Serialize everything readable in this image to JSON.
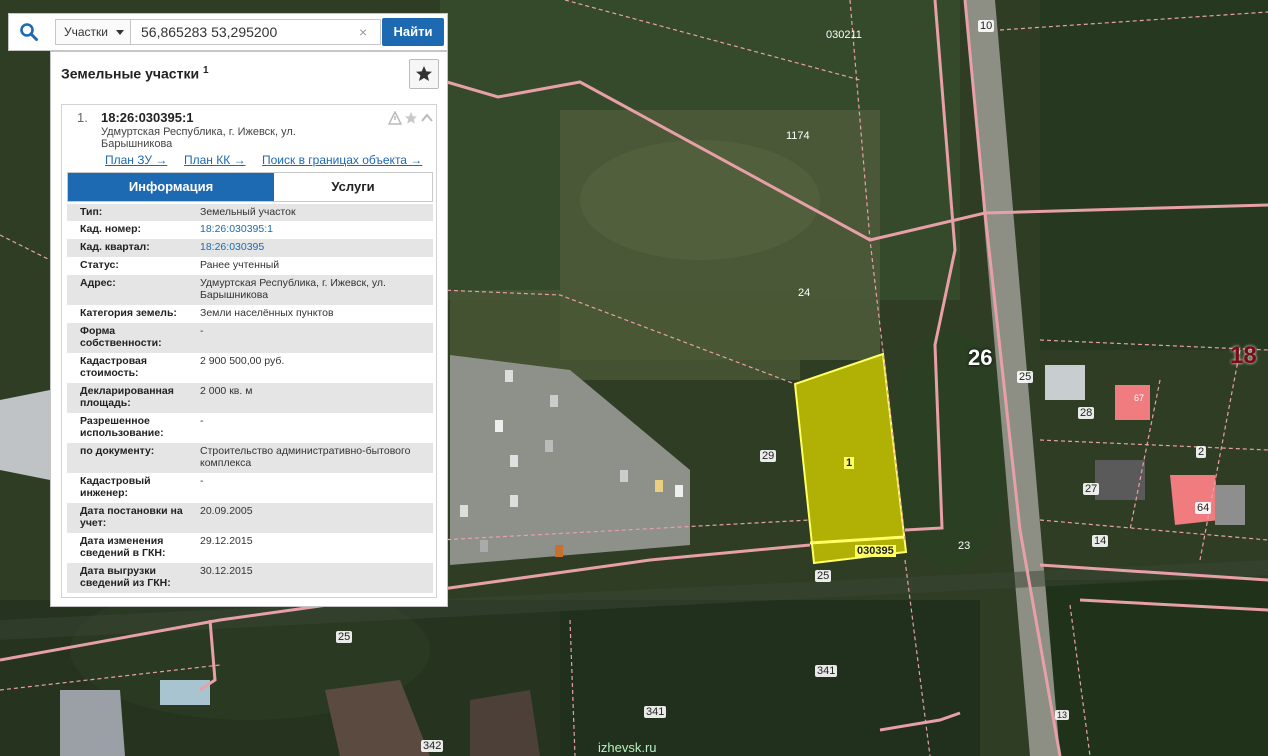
{
  "search": {
    "type_label": "Участки",
    "query": "56,865283 53,295200",
    "clear_symbol": "×",
    "find_label": "Найти"
  },
  "panel": {
    "title": "Земельные участки",
    "title_count": "1",
    "item": {
      "number": "1.",
      "cad_number": "18:26:030395:1",
      "address": "Удмуртская Республика, г. Ижевск, ул. Барышникова",
      "links": [
        "План ЗУ →",
        "План КК →",
        "Поиск в границах объекта →"
      ]
    },
    "tabs": [
      "Информация",
      "Услуги"
    ],
    "properties": [
      {
        "key": "Тип:",
        "value": "Земельный участок"
      },
      {
        "key": "Кад. номер:",
        "value": "18:26:030395:1"
      },
      {
        "key": "Кад. квартал:",
        "value": "18:26:030395"
      },
      {
        "key": "Статус:",
        "value": "Ранее учтенный"
      },
      {
        "key": "Адрес:",
        "value": "Удмуртская Республика, г. Ижевск, ул. Барышникова"
      },
      {
        "key": "Категория земель:",
        "value": "Земли населённых пунктов"
      },
      {
        "key": "Форма собственности:",
        "value": "-"
      },
      {
        "key": "Кадастровая стоимость:",
        "value": "2 900 500,00 руб."
      },
      {
        "key": "Декларированная площадь:",
        "value": "2 000 кв. м"
      },
      {
        "key": "Разрешенное использование:",
        "value": "-"
      },
      {
        "key": "по документу:",
        "value": "Строительство административно-бытового комплекса"
      },
      {
        "key": "Кадастровый инженер:",
        "value": "-"
      },
      {
        "key": "Дата постановки на учет:",
        "value": "20.09.2005"
      },
      {
        "key": "Дата изменения сведений в ГКН:",
        "value": "29.12.2015"
      },
      {
        "key": "Дата выгрузки сведений из ГКН:",
        "value": "30.12.2015"
      }
    ]
  },
  "map": {
    "labels": [
      "030211",
      "10",
      "1174",
      "24",
      "26",
      "18",
      "25",
      "28",
      "27",
      "2",
      "64",
      "14",
      "29",
      "1",
      "030395",
      "23",
      "25",
      "25",
      "341",
      "341",
      "342",
      "67",
      "13"
    ],
    "site": "izhevsk.ru",
    "colors": {
      "parcel_fill": "#c8c400",
      "boundary": "#e8a0a8",
      "selected": "#ffff66"
    }
  }
}
